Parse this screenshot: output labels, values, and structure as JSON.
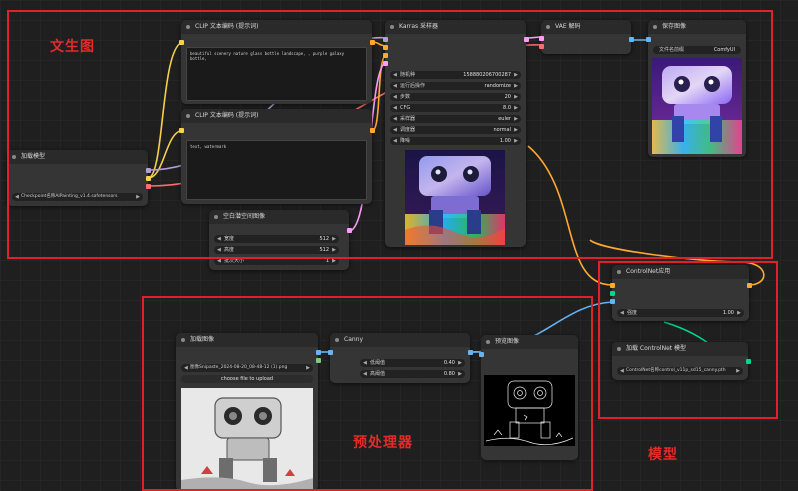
{
  "sections": {
    "txt2img": "文生图",
    "preprocessor": "预处理器",
    "model": "模型"
  },
  "nodes": {
    "load_checkpoint": {
      "title": "加载模型",
      "ckpt_name": "Checkpoint名称",
      "ckpt_value": "AIPainting_v1.4.safetensors"
    },
    "clip_pos": {
      "title": "CLIP 文本编码 (提示词)",
      "text": "beautiful scenery nature glass bottle landscape, , purple galaxy bottle,"
    },
    "clip_neg": {
      "title": "CLIP 文本编码 (提示词)",
      "text": "text, watermark"
    },
    "empty_latent": {
      "title": "空白潜空间图像",
      "fields": [
        {
          "label": "宽度",
          "value": "512"
        },
        {
          "label": "高度",
          "value": "512"
        },
        {
          "label": "批次大小",
          "value": "1"
        }
      ]
    },
    "ksampler": {
      "title": "Karras 采样器",
      "fields": [
        {
          "label": "随机种",
          "value": "158880206700287"
        },
        {
          "label": "运行后操作",
          "value": "randomize"
        },
        {
          "label": "步数",
          "value": "20"
        },
        {
          "label": "CFG",
          "value": "8.0"
        },
        {
          "label": "采样器",
          "value": "euler"
        },
        {
          "label": "调度器",
          "value": "normal"
        },
        {
          "label": "降噪",
          "value": "1.00"
        }
      ]
    },
    "vae_decode": {
      "title": "VAE 解码"
    },
    "save_image": {
      "title": "保存图像",
      "prefix_label": "文件名前缀",
      "prefix_value": "ComfyUI"
    },
    "controlnet_apply": {
      "title": "ControlNet应用",
      "strength_label": "强度",
      "strength_value": "1.00"
    },
    "controlnet_loader": {
      "title": "加载 ControlNet 模型",
      "name_label": "ControlNet名称",
      "name_value": "control_v11p_sd15_canny.pth"
    },
    "load_image": {
      "title": "加载图像",
      "image_label": "图像",
      "image_value": "Snipaste_2024-08-20_08-48-12 (1).png",
      "upload_label": "choose file to upload"
    },
    "canny": {
      "title": "Canny",
      "fields": [
        {
          "label": "低阈值",
          "value": "0.40"
        },
        {
          "label": "高阈值",
          "value": "0.80"
        }
      ]
    },
    "preview_image": {
      "title": "预览图像"
    }
  },
  "colors": {
    "section_border": "#e0202a",
    "wire_model": "#b39ddb",
    "wire_clip": "#f6d14b",
    "wire_vae": "#ff6e6e",
    "wire_conditioning": "#ffa931",
    "wire_latent": "#ff9cf9",
    "wire_image": "#64b5f6",
    "wire_controlnet": "#00d78d"
  }
}
